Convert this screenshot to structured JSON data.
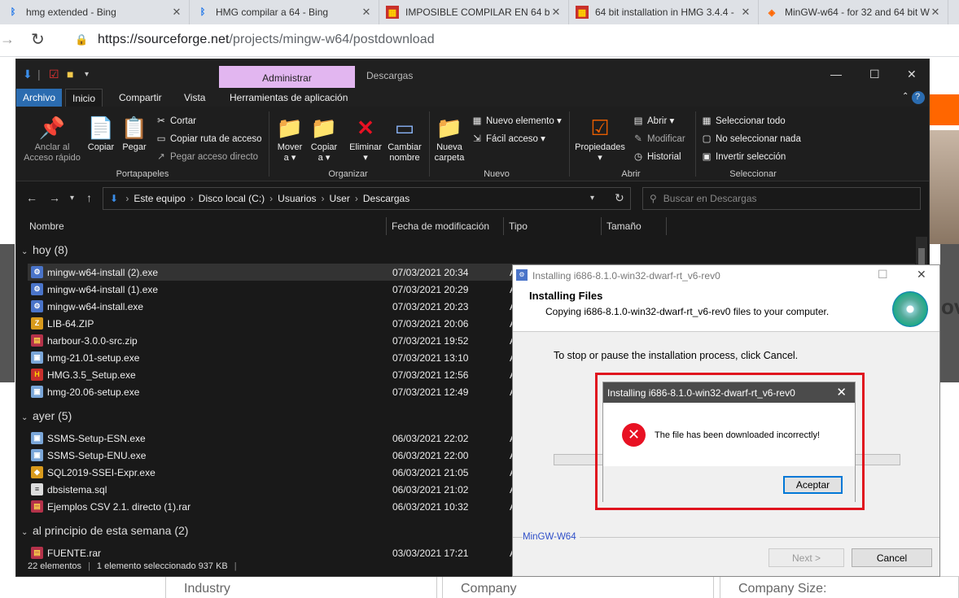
{
  "browser": {
    "tabs": [
      {
        "title": "hmg extended - Bing",
        "icon": "bing-icon"
      },
      {
        "title": "HMG compilar a 64 - Bing",
        "icon": "bing-icon"
      },
      {
        "title": "IMPOSIBLE COMPILAR EN 64 bit",
        "icon": "forum-icon"
      },
      {
        "title": "64 bit installation in HMG 3.4.4 -",
        "icon": "forum-icon"
      },
      {
        "title": "MinGW-w64 - for 32 and 64 bit W",
        "icon": "sourceforge-icon"
      }
    ],
    "url_host": "https://sourceforge.net",
    "url_path": "/projects/mingw-w64/postdownload"
  },
  "webpage": {
    "heading_fragment": "ov",
    "form_fields": [
      "Industry",
      "Company",
      "Company Size:"
    ]
  },
  "explorer": {
    "context_tab": "Administrar",
    "window_title": "Descargas",
    "ribbon_tabs": [
      "Archivo",
      "Inicio",
      "Compartir",
      "Vista",
      "Herramientas de aplicación"
    ],
    "ribbon": {
      "pin_label": "Anclar al\nAcceso rápido",
      "copy": "Copiar",
      "paste": "Pegar",
      "cut": "Cortar",
      "copy_path": "Copiar ruta de acceso",
      "paste_shortcut": "Pegar acceso directo",
      "move": "Mover\na ▾",
      "copy_to": "Copiar\na ▾",
      "delete": "Eliminar\n▾",
      "rename": "Cambiar\nnombre",
      "new_folder": "Nueva\ncarpeta",
      "new_item": "Nuevo elemento ▾",
      "easy_access": "Fácil acceso ▾",
      "properties": "Propiedades\n▾",
      "open": "Abrir ▾",
      "edit": "Modificar",
      "history": "Historial",
      "select_all": "Seleccionar todo",
      "select_none": "No seleccionar nada",
      "invert": "Invertir selección",
      "groups": [
        "Portapapeles",
        "Organizar",
        "Nuevo",
        "Abrir",
        "Seleccionar"
      ]
    },
    "breadcrumb": [
      "Este equipo",
      "Disco local (C:)",
      "Usuarios",
      "User",
      "Descargas"
    ],
    "search_placeholder": "Buscar en Descargas",
    "columns": [
      "Nombre",
      "Fecha de modificación",
      "Tipo",
      "Tamaño"
    ],
    "groups": [
      {
        "label": "hoy (8)",
        "files": [
          {
            "name": "mingw-w64-install (2).exe",
            "date": "07/03/2021 20:34",
            "type": "A",
            "icon": "installer-icon",
            "selected": true
          },
          {
            "name": "mingw-w64-install (1).exe",
            "date": "07/03/2021 20:29",
            "type": "A",
            "icon": "installer-icon"
          },
          {
            "name": "mingw-w64-install.exe",
            "date": "07/03/2021 20:23",
            "type": "A",
            "icon": "installer-icon"
          },
          {
            "name": "LIB-64.ZIP",
            "date": "07/03/2021 20:06",
            "type": "A",
            "icon": "zip-icon"
          },
          {
            "name": "harbour-3.0.0-src.zip",
            "date": "07/03/2021 19:52",
            "type": "A",
            "icon": "rar-icon"
          },
          {
            "name": "hmg-21.01-setup.exe",
            "date": "07/03/2021 13:10",
            "type": "A",
            "icon": "setup-icon"
          },
          {
            "name": "HMG.3.5_Setup.exe",
            "date": "07/03/2021 12:56",
            "type": "A",
            "icon": "hmg-icon"
          },
          {
            "name": "hmg-20.06-setup.exe",
            "date": "07/03/2021 12:49",
            "type": "A",
            "icon": "setup-icon"
          }
        ]
      },
      {
        "label": "ayer (5)",
        "files": [
          {
            "name": "SSMS-Setup-ESN.exe",
            "date": "06/03/2021 22:02",
            "type": "A",
            "icon": "setup-icon"
          },
          {
            "name": "SSMS-Setup-ENU.exe",
            "date": "06/03/2021 22:00",
            "type": "A",
            "icon": "setup-icon"
          },
          {
            "name": "SQL2019-SSEI-Expr.exe",
            "date": "06/03/2021 21:05",
            "type": "A",
            "icon": "sql-server-icon"
          },
          {
            "name": "dbsistema.sql",
            "date": "06/03/2021 21:02",
            "type": "A",
            "icon": "sql-file-icon"
          },
          {
            "name": "Ejemplos CSV 2.1. directo (1).rar",
            "date": "06/03/2021 10:32",
            "type": "A",
            "icon": "rar-icon"
          }
        ]
      },
      {
        "label": "al principio de esta semana (2)",
        "files": [
          {
            "name": "FUENTE.rar",
            "date": "03/03/2021 17:21",
            "type": "A",
            "icon": "rar-icon"
          }
        ]
      }
    ],
    "status": {
      "count": "22 elementos",
      "selection": "1 elemento seleccionado  937 KB"
    }
  },
  "installer": {
    "title": "Installing i686-8.1.0-win32-dwarf-rt_v6-rev0",
    "heading": "Installing Files",
    "subheading": "Copying i686-8.1.0-win32-dwarf-rt_v6-rev0 files to your computer.",
    "message": "To stop or pause the installation process, click Cancel.",
    "brand": "MinGW-W64",
    "next_button": "Next >",
    "cancel_button": "Cancel"
  },
  "error_dialog": {
    "title": "Installing i686-8.1.0-win32-dwarf-rt_v6-rev0",
    "message": "The file has been downloaded incorrectly!",
    "ok_button": "Aceptar",
    "highlight_color": "#e0141e"
  }
}
